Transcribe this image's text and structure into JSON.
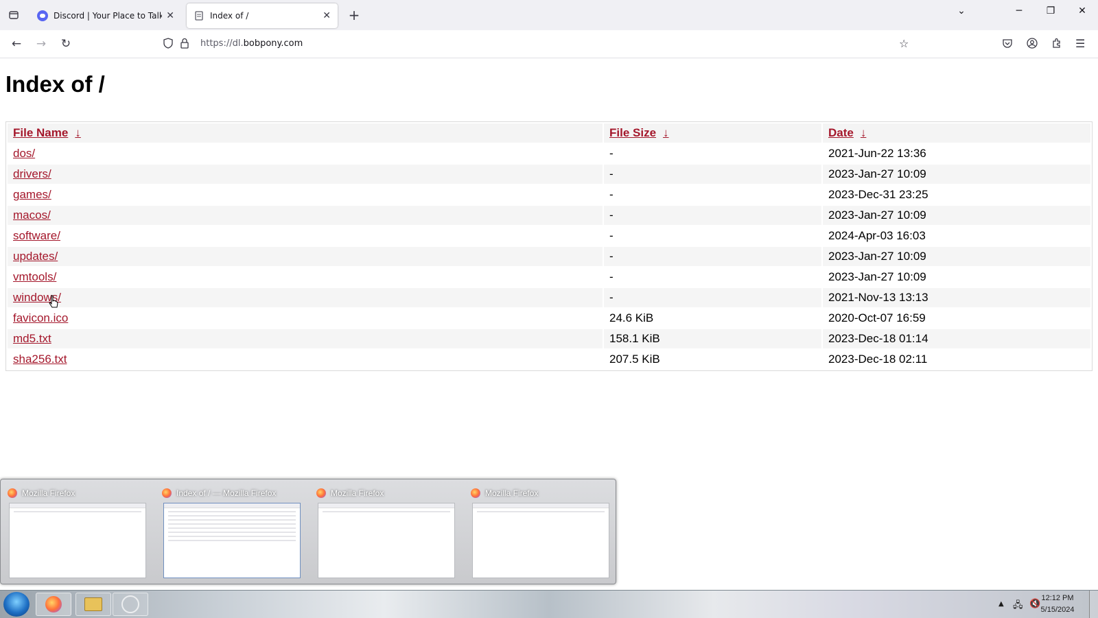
{
  "browser": {
    "tabs": [
      {
        "title": "Discord | Your Place to Talk and",
        "active": false
      },
      {
        "title": "Index of /",
        "active": true
      }
    ],
    "url_prefix": "https://dl.",
    "url_domain": "bobpony.com"
  },
  "page": {
    "title": "Index of /",
    "columns": {
      "name": "File Name",
      "size": "File Size",
      "date": "Date",
      "sort_arrow": "↓"
    },
    "rows": [
      {
        "name": "dos/",
        "size": "-",
        "date": "2021-Jun-22 13:36"
      },
      {
        "name": "drivers/",
        "size": "-",
        "date": "2023-Jan-27 10:09"
      },
      {
        "name": "games/",
        "size": "-",
        "date": "2023-Dec-31 23:25"
      },
      {
        "name": "macos/",
        "size": "-",
        "date": "2023-Jan-27 10:09"
      },
      {
        "name": "software/",
        "size": "-",
        "date": "2024-Apr-03 16:03"
      },
      {
        "name": "updates/",
        "size": "-",
        "date": "2023-Jan-27 10:09"
      },
      {
        "name": "vmtools/",
        "size": "-",
        "date": "2023-Jan-27 10:09"
      },
      {
        "name": "windows/",
        "size": "-",
        "date": "2021-Nov-13 13:13"
      },
      {
        "name": "favicon.ico",
        "size": "24.6 KiB",
        "date": "2020-Oct-07 16:59"
      },
      {
        "name": "md5.txt",
        "size": "158.1 KiB",
        "date": "2023-Dec-18 01:14"
      },
      {
        "name": "sha256.txt",
        "size": "207.5 KiB",
        "date": "2023-Dec-18 02:11"
      }
    ]
  },
  "previews": [
    {
      "title": "Mozilla Firefox"
    },
    {
      "title": "Index of / — Mozilla Firefox"
    },
    {
      "title": "Mozilla Firefox"
    },
    {
      "title": "Mozilla Firefox"
    }
  ],
  "taskbar": {
    "time": "12:12 PM",
    "date": "5/15/2024"
  },
  "colors": {
    "link": "#a4172b",
    "tabbar_bg": "#f0f0f4"
  }
}
